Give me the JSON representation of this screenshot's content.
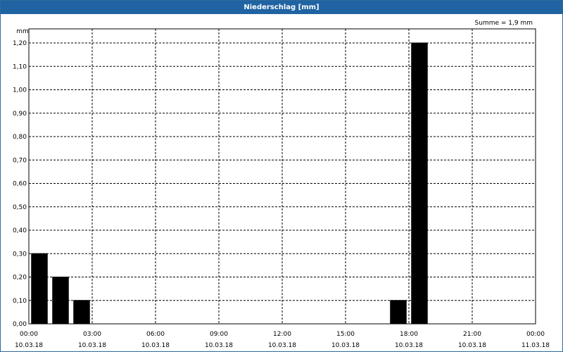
{
  "window": {
    "title": "Niederschlag [mm]"
  },
  "chart_data": {
    "type": "bar",
    "title": "Niederschlag [mm]",
    "unit_label": "mm",
    "sum_annotation": "Summe = 1,9 mm",
    "ylim": [
      0,
      1.2
    ],
    "y_ticks": [
      0.0,
      0.1,
      0.2,
      0.3,
      0.4,
      0.5,
      0.6,
      0.7,
      0.8,
      0.9,
      1.0,
      1.1,
      1.2
    ],
    "y_tick_labels": [
      "0,00",
      "0,10",
      "0,20",
      "0,30",
      "0,40",
      "0,50",
      "0,60",
      "0,70",
      "0,80",
      "0,90",
      "1,00",
      "1,10",
      "1,20"
    ],
    "xlim_hours": [
      0,
      24
    ],
    "x_ticks_hours": [
      0,
      3,
      6,
      9,
      12,
      15,
      18,
      21,
      24
    ],
    "x_tick_times": [
      "00:00",
      "03:00",
      "06:00",
      "09:00",
      "12:00",
      "15:00",
      "18:00",
      "21:00",
      "00:00"
    ],
    "x_tick_dates": [
      "10.03.18",
      "10.03.18",
      "10.03.18",
      "10.03.18",
      "10.03.18",
      "10.03.18",
      "10.03.18",
      "10.03.18",
      "11.03.18"
    ],
    "bar_width_hours": 0.75,
    "bars": [
      {
        "time": "10.03.18 00:00",
        "value": 0.3
      },
      {
        "time": "10.03.18 01:00",
        "value": 0.2
      },
      {
        "time": "10.03.18 02:00",
        "value": 0.1
      },
      {
        "time": "10.03.18 17:00",
        "value": 0.1
      },
      {
        "time": "10.03.18 18:00",
        "value": 1.2
      }
    ],
    "grid": true,
    "bar_color": "#000000"
  }
}
